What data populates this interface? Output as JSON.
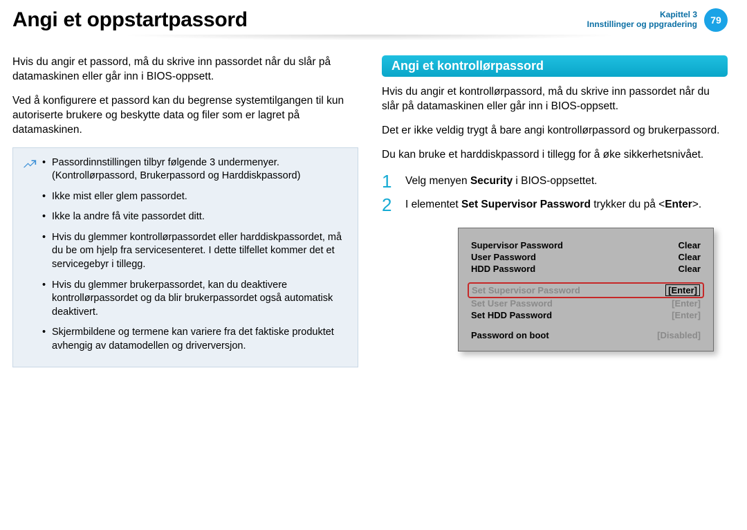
{
  "header": {
    "title": "Angi et oppstartpassord",
    "chapter_line1": "Kapittel 3",
    "chapter_line2": "Innstillinger og ppgradering",
    "page_number": "79"
  },
  "left_col": {
    "para1": "Hvis du angir et passord, må du skrive inn passordet når du slår på datamaskinen eller går inn i BIOS-oppsett.",
    "para2": "Ved å konfigurere et passord kan du begrense systemtilgangen til kun autoriserte brukere og beskytte data og filer som er lagret på datamaskinen.",
    "notes": [
      "Passordinnstillingen tilbyr følgende 3 undermenyer. (Kontrollørpassord, Brukerpassord og Harddiskpassord)",
      "Ikke mist eller glem passordet.",
      "Ikke la andre få vite passordet ditt.",
      "Hvis du glemmer kontrollørpassordet eller harddiskpassordet, må du be om hjelp fra servicesenteret. I dette tilfellet kommer det et servicegebyr i tillegg.",
      "Hvis du glemmer brukerpassordet, kan du deaktivere kontrollørpassordet og da blir brukerpassordet også automatisk deaktivert.",
      "Skjermbildene og termene kan variere fra det faktiske produktet avhengig av datamodellen og driverversjon."
    ]
  },
  "right_col": {
    "section_heading": "Angi et kontrollørpassord",
    "para1": "Hvis du angir et kontrollørpassord, må du skrive inn passordet når du slår på datamaskinen eller går inn i BIOS-oppsett.",
    "para2": "Det er ikke veldig trygt å bare angi kontrollørpassord og brukerpassord.",
    "para3": "Du kan bruke et harddiskpassord i tillegg for å øke sikkerhetsnivået.",
    "step1_pre": "Velg menyen ",
    "step1_bold": "Security",
    "step1_post": " i BIOS-oppsettet.",
    "step2_pre": "I elementet ",
    "step2_bold": "Set Supervisor Password",
    "step2_mid": " trykker du på <",
    "step2_enter": "Enter",
    "step2_post": ">."
  },
  "bios": {
    "rows_status": [
      {
        "label": "Supervisor Password",
        "value": "Clear"
      },
      {
        "label": "User Password",
        "value": "Clear"
      },
      {
        "label": "HDD Password",
        "value": "Clear"
      }
    ],
    "highlight": {
      "label": "Set Supervisor Password",
      "value": "[Enter]"
    },
    "rows_set": [
      {
        "label": "Set User Password",
        "value": "[Enter]"
      },
      {
        "label": "Set HDD Password",
        "value": "[Enter]"
      }
    ],
    "boot_row": {
      "label": "Password on boot",
      "value": "[Disabled]"
    }
  }
}
